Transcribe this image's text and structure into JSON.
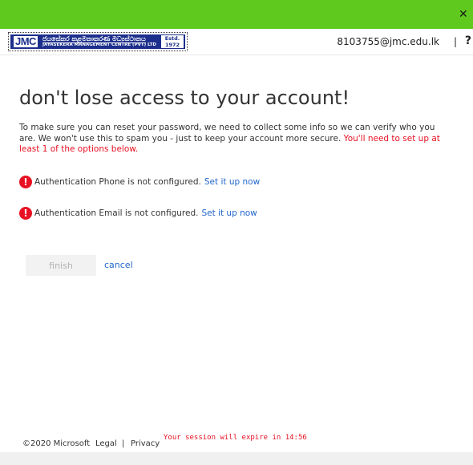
{
  "window": {
    "close_glyph": "✕",
    "accent_color": "#5fc91e"
  },
  "header": {
    "logo": {
      "abbr": "JMC",
      "name_sinhala": "ජයසේකර කළමනාකරණ මධ්‍යස්ථානය",
      "name_english": "JAYASEKERA MANAGEMENT CENTRE (PVT) LTD",
      "estd_label": "Estd.",
      "estd_year": "1972"
    },
    "user_email": "8103755@jmc.edu.lk",
    "separator": "|",
    "help_label": "?"
  },
  "main": {
    "title": "don't lose access to your account!",
    "description": "To make sure you can reset your password, we need to collect some info so we can verify who you are. We won't use this to spam you - just to keep your account more secure.",
    "description_warning": "You'll need to set up at least 1 of the options below.",
    "methods": [
      {
        "icon": "alert-icon",
        "status": "Authentication Phone is not configured.",
        "link": "Set it up now"
      },
      {
        "icon": "alert-icon",
        "status": "Authentication Email is not configured.",
        "link": "Set it up now"
      }
    ],
    "finish_label": "finish",
    "cancel_label": "cancel"
  },
  "footer": {
    "copyright": "©2020 Microsoft",
    "legal": "Legal",
    "separator": "|",
    "privacy": "Privacy",
    "session_message": "Your session will expire in 14:56"
  }
}
